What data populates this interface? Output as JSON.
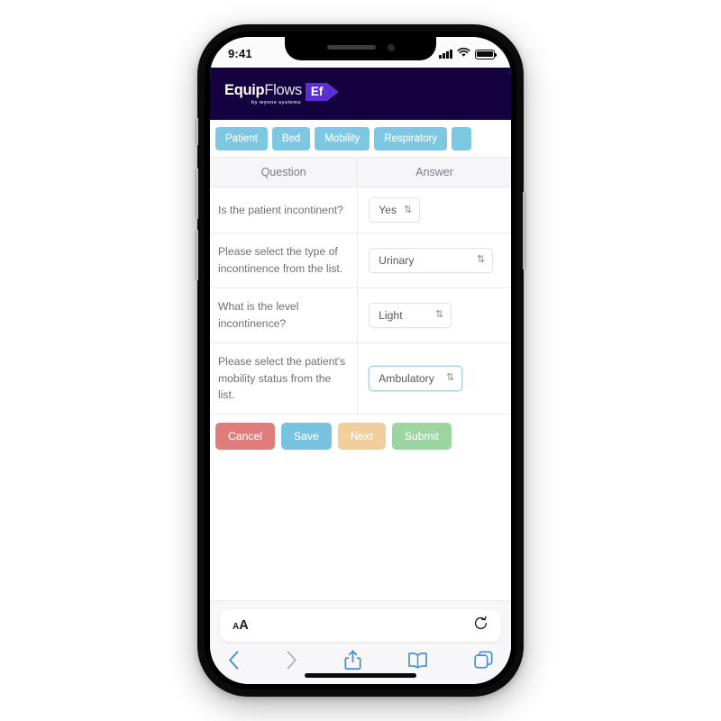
{
  "device": {
    "status_bar": {
      "time": "9:41",
      "signal_icon": "cellular-signal-icon",
      "wifi_icon": "wifi-icon",
      "battery_icon": "battery-full-icon"
    },
    "home_indicator": "home-indicator"
  },
  "app_header": {
    "logo_equip": "Equip",
    "logo_flows": "Flows",
    "logo_badge": "Ef",
    "tagline": "by wynne systems",
    "background_color": "#130140",
    "badge_color": "#5b2fd4"
  },
  "tabs": [
    {
      "label": "Patient",
      "active": true
    },
    {
      "label": "Bed",
      "active": false
    },
    {
      "label": "Mobility",
      "active": false
    },
    {
      "label": "Respiratory",
      "active": false
    },
    {
      "label": "",
      "active": false
    }
  ],
  "tab_color": "#7cc7e2",
  "table": {
    "headers": {
      "question": "Question",
      "answer": "Answer"
    },
    "rows": [
      {
        "question": "Is the patient incontinent?",
        "answer_value": "Yes",
        "width_class": "w-auto",
        "focused": false
      },
      {
        "question": "Please select the type of incontinence from the list.",
        "answer_value": "Urinary",
        "width_class": "w-wide",
        "focused": false
      },
      {
        "question": "What is the level incontinence?",
        "answer_value": "Light",
        "width_class": "w-mid",
        "focused": false
      },
      {
        "question": "Please select the patient's mobility status from the list.",
        "answer_value": "Ambulatory",
        "width_class": "w-amb",
        "focused": true
      }
    ],
    "select_caret": "⇅"
  },
  "actions": [
    {
      "label": "Cancel",
      "id": "btn-cancel",
      "color": "#e07c7c"
    },
    {
      "label": "Save",
      "id": "btn-save",
      "color": "#78c3e0"
    },
    {
      "label": "Next",
      "id": "btn-next",
      "color": "#f0cf9c"
    },
    {
      "label": "Submit",
      "id": "btn-submit",
      "color": "#9cd4a2"
    }
  ],
  "safari": {
    "text_size_small": "A",
    "text_size_large": "A",
    "reload_icon": "reload-icon",
    "toolbar": {
      "back": "back-chevron-icon",
      "forward": "forward-chevron-icon",
      "share": "share-icon",
      "bookmarks": "bookmarks-icon",
      "tabs": "tabs-icon"
    }
  }
}
